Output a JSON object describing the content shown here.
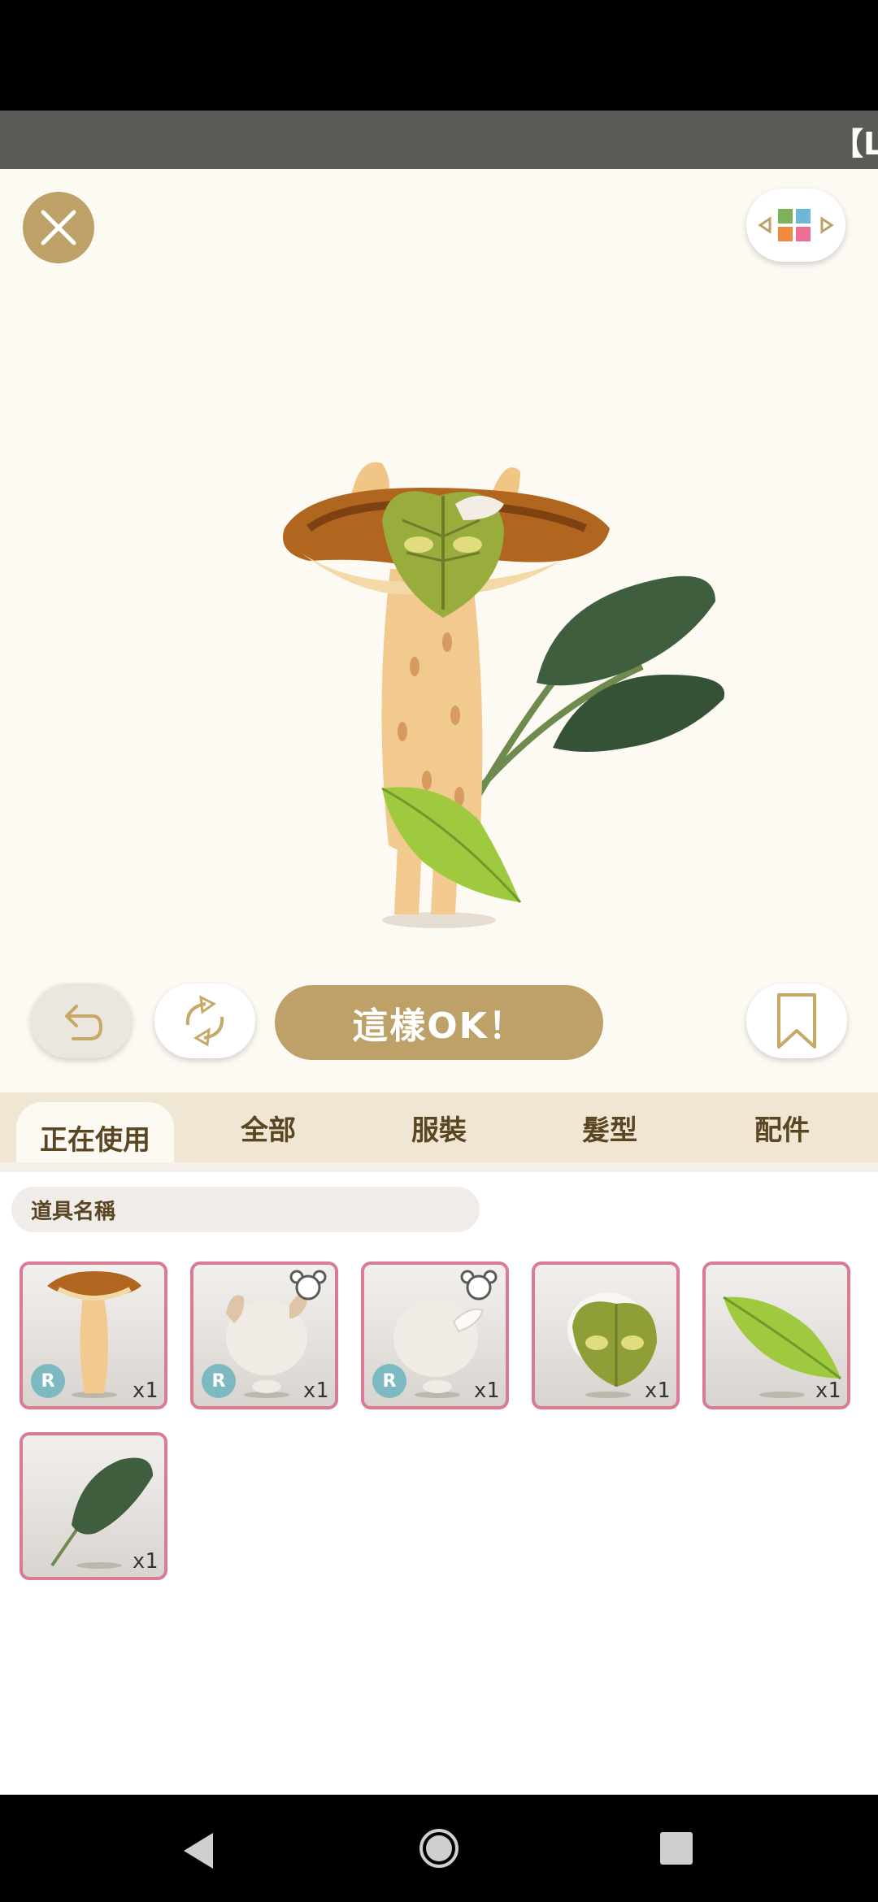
{
  "ticker": {
    "text": "【Li"
  },
  "toolbar": {
    "ok_label": "這樣OK！"
  },
  "tabs": [
    {
      "label": "正在使用",
      "active": true
    },
    {
      "label": "全部",
      "active": false
    },
    {
      "label": "服裝",
      "active": false
    },
    {
      "label": "髮型",
      "active": false
    },
    {
      "label": "配件",
      "active": false
    }
  ],
  "search": {
    "placeholder": "道具名稱"
  },
  "items": [
    {
      "name": "mushroom-cap-outfit",
      "rarity": "R",
      "quantity": "x1"
    },
    {
      "name": "cat-ears-hairstyle",
      "rarity": "R",
      "quantity": "x1"
    },
    {
      "name": "horn-hairstyle",
      "rarity": "R",
      "quantity": "x1"
    },
    {
      "name": "leaf-mask",
      "rarity": "",
      "quantity": "x1"
    },
    {
      "name": "green-leaf-accessory",
      "rarity": "",
      "quantity": "x1"
    },
    {
      "name": "kale-leaf-accessory",
      "rarity": "",
      "quantity": "x1"
    }
  ],
  "colors": {
    "accent": "#bda168",
    "item_border": "#d97b93",
    "tab_bar": "#efe6d3",
    "rare_badge": "#7cb9c1"
  },
  "icons": {
    "close": "close-icon",
    "grid": "grid-icon",
    "undo": "undo-icon",
    "refresh": "refresh-icon",
    "bookmark": "bookmark-icon"
  }
}
